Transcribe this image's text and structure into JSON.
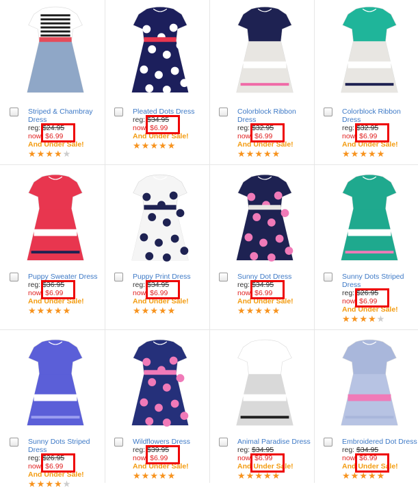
{
  "products": [
    {
      "name": "Striped & Chambray Dress",
      "reg_label": "reg:",
      "reg_price": "$24.95",
      "now_label": "now:",
      "now_price": "$6.99",
      "sale": "And Under Sale!",
      "rating": 4.5,
      "dress": {
        "top": "#ffffff",
        "stripe": "#1a1a1a",
        "waist": "#e64b5a",
        "skirt": "#8fa7c7"
      }
    },
    {
      "name": "Pleated Dots Dress",
      "reg_label": "reg:",
      "reg_price": "$34.95",
      "now_label": "now:",
      "now_price": "$6.99",
      "sale": "And Under Sale!",
      "rating": 5,
      "dress": {
        "top": "#1c1f5c",
        "waist": "#e8364f",
        "skirt": "#1c1f5c",
        "dots": "#ffffff"
      }
    },
    {
      "name": "Colorblock Ribbon Dress",
      "reg_label": "reg:",
      "reg_price": "$32.95",
      "now_label": "now:",
      "now_price": "$6.99",
      "sale": "And Under Sale!",
      "rating": 5,
      "dress": {
        "top": "#1e2252",
        "band": "#ffffff",
        "accent": "#f06aa7",
        "skirt": "#e8e6e2"
      }
    },
    {
      "name": "Colorblock Ribbon Dress",
      "reg_label": "reg:",
      "reg_price": "$32.95",
      "now_label": "now:",
      "now_price": "$6.99",
      "sale": "And Under Sale!",
      "rating": 5,
      "dress": {
        "top": "#1fb59a",
        "band": "#ffffff",
        "accent": "#1e2252",
        "skirt": "#e8e6e2"
      }
    },
    {
      "name": "Puppy Sweater Dress",
      "reg_label": "reg:",
      "reg_price": "$36.95",
      "now_label": "now:",
      "now_price": "$6.99",
      "sale": "And Under Sale!",
      "rating": 5,
      "dress": {
        "top": "#e8364f",
        "band": "#ffffff",
        "accent": "#1e2252",
        "skirt": "#e8364f"
      }
    },
    {
      "name": "Puppy Print Dress",
      "reg_label": "reg:",
      "reg_price": "$34.95",
      "now_label": "now:",
      "now_price": "$6.99",
      "sale": "And Under Sale!",
      "rating": 5,
      "dress": {
        "top": "#f5f5f5",
        "waist": "#1e2252",
        "skirt": "#f5f5f5",
        "dots": "#1e2252"
      }
    },
    {
      "name": "Sunny Dot Dress",
      "reg_label": "reg:",
      "reg_price": "$34.95",
      "now_label": "now:",
      "now_price": "$6.99",
      "sale": "And Under Sale!",
      "rating": 5,
      "dress": {
        "top": "#1e2252",
        "waist": "#e8e6e2",
        "skirt": "#1e2252",
        "dots": "#f07ab8"
      }
    },
    {
      "name": "Sunny Dots Striped Dress",
      "reg_label": "reg:",
      "reg_price": "$26.95",
      "now_label": "now:",
      "now_price": "$6.99",
      "sale": "And Under Sale!",
      "rating": 4,
      "dress": {
        "top": "#1fa98e",
        "band": "#ffffff",
        "accent": "#f07ab8",
        "skirt": "#1fa98e"
      }
    },
    {
      "name": "Sunny Dots Striped Dress",
      "reg_label": "reg:",
      "reg_price": "$26.95",
      "now_label": "now:",
      "now_price": "$6.99",
      "sale": "And Under Sale!",
      "rating": 4,
      "dress": {
        "top": "#5b5fd8",
        "band": "#ffffff",
        "accent": "#9b9ef0",
        "skirt": "#5b5fd8"
      }
    },
    {
      "name": "Wildflowers Dress",
      "reg_label": "reg:",
      "reg_price": "$39.95",
      "now_label": "now:",
      "now_price": "$6.99",
      "sale": "And Under Sale!",
      "rating": 5,
      "dress": {
        "top": "#25307a",
        "waist": "#f07ab8",
        "skirt": "#25307a",
        "dots": "#f07ab8"
      }
    },
    {
      "name": "Animal Paradise Dress",
      "reg_label": "reg:",
      "reg_price": "$34.95",
      "now_label": "now:",
      "now_price": "$6.99",
      "sale": "And Under Sale!",
      "rating": 5,
      "dress": {
        "top": "#ffffff",
        "band": "#ffffff",
        "accent": "#222222",
        "skirt": "#d9d9d9"
      }
    },
    {
      "name": "Embroidered Dot Dress",
      "reg_label": "reg:",
      "reg_price": "$34.95",
      "now_label": "now:",
      "now_price": "$6.99",
      "sale": "And Under Sale!",
      "rating": 5,
      "dress": {
        "top": "#a9b7db",
        "band": "#f07ab8",
        "accent": "#a9b7db",
        "skirt": "#b7c3e3"
      }
    }
  ],
  "colors": {
    "link": "#3d79c6",
    "now": "#e02020",
    "sale": "#f39c12",
    "highlight": "#ee0000",
    "star": "#f7931e"
  }
}
